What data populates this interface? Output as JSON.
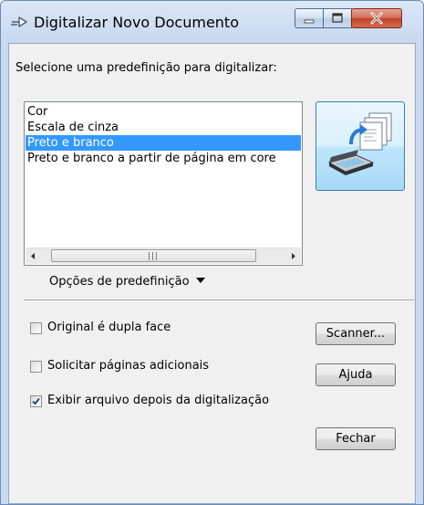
{
  "window": {
    "title": "Digitalizar Novo Documento"
  },
  "titlebar_buttons": {
    "minimize_icon": "minimize-icon",
    "maximize_icon": "maximize-icon",
    "close_icon": "close-icon"
  },
  "presets": {
    "prompt": "Selecione uma predefinição para digitalizar:",
    "items": [
      {
        "label": "Cor",
        "selected": false
      },
      {
        "label": "Escala de cinza",
        "selected": false
      },
      {
        "label": "Preto e branco",
        "selected": true
      },
      {
        "label": "Preto e branco a partir de página em core",
        "selected": false
      }
    ],
    "options_link": "Opções de predefinição",
    "scan_icon": "scanner-documents-icon"
  },
  "options": {
    "duplex": {
      "label": "Original é dupla face",
      "checked": false
    },
    "request_pages": {
      "label": "Solicitar páginas adicionais",
      "checked": false
    },
    "show_file": {
      "label": "Exibir arquivo depois da digitalização",
      "checked": true
    }
  },
  "buttons": {
    "scanner": "Scanner...",
    "help": "Ajuda",
    "close": "Fechar"
  },
  "colors": {
    "selection": "#3399ff",
    "close_button": "#c0432b",
    "accent": "#3c7fb1"
  }
}
